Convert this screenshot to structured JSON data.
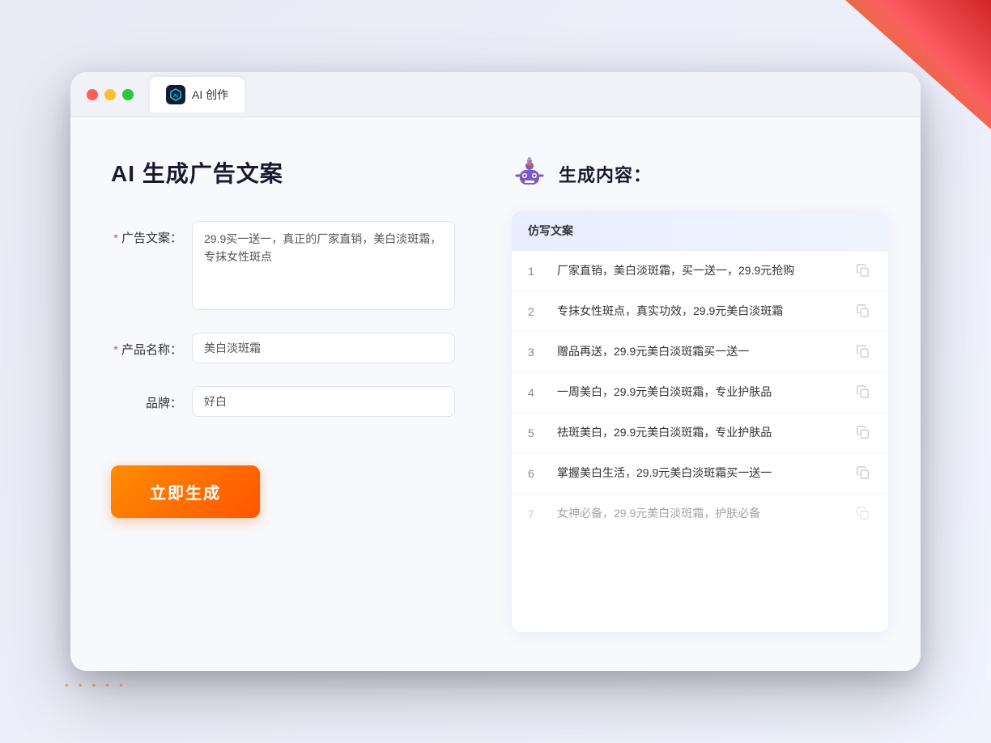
{
  "browser": {
    "tab_icon": "AI",
    "tab_label": "AI 创作"
  },
  "left_panel": {
    "page_title": "AI 生成广告文案",
    "form": {
      "ad_label": "广告文案：",
      "ad_required": "*",
      "ad_value": "29.9买一送一，真正的厂家直销，美白淡斑霜，专抹女性斑点",
      "product_label": "产品名称：",
      "product_required": "*",
      "product_value": "美白淡斑霜",
      "brand_label": "品牌：",
      "brand_value": "好白"
    },
    "generate_button": "立即生成"
  },
  "right_panel": {
    "result_title": "生成内容：",
    "table_header": "仿写文案",
    "results": [
      {
        "id": 1,
        "text": "厂家直销，美白淡斑霜，买一送一，29.9元抢购",
        "faded": false
      },
      {
        "id": 2,
        "text": "专抹女性斑点，真实功效，29.9元美白淡斑霜",
        "faded": false
      },
      {
        "id": 3,
        "text": "赠品再送，29.9元美白淡斑霜买一送一",
        "faded": false
      },
      {
        "id": 4,
        "text": "一周美白，29.9元美白淡斑霜，专业护肤品",
        "faded": false
      },
      {
        "id": 5,
        "text": "祛斑美白，29.9元美白淡斑霜，专业护肤品",
        "faded": false
      },
      {
        "id": 6,
        "text": "掌握美白生活，29.9元美白淡斑霜买一送一",
        "faded": false
      },
      {
        "id": 7,
        "text": "女神必备，29.9元美白淡斑霜，护肤必备",
        "faded": true
      }
    ]
  },
  "colors": {
    "accent_orange": "#ff6600",
    "accent_blue": "#5b7cff",
    "required_red": "#ff4d4f"
  }
}
